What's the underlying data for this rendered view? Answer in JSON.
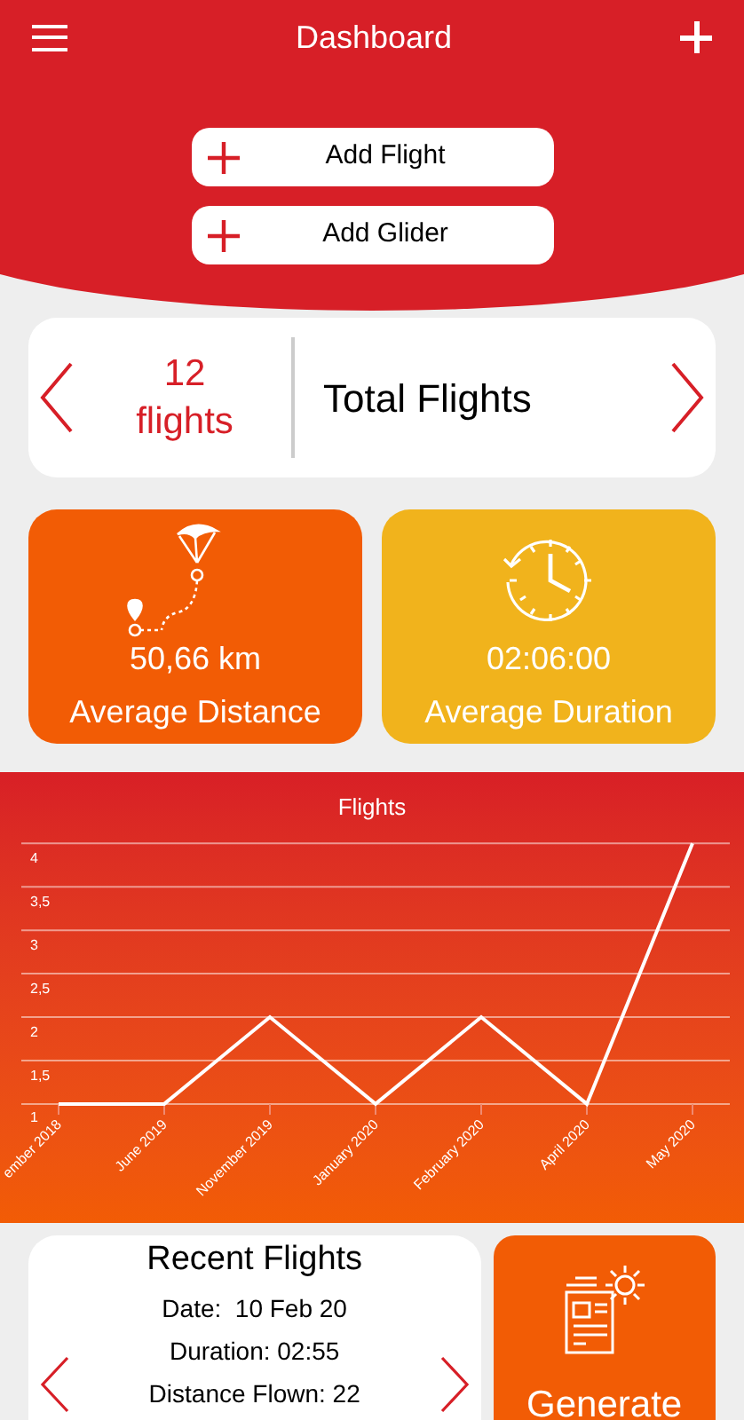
{
  "header": {
    "title": "Dashboard"
  },
  "quick_actions": [
    {
      "label": "Add Flight"
    },
    {
      "label": "Add Glider"
    }
  ],
  "total": {
    "value": "12 flights",
    "label": "Total Flights"
  },
  "stats": [
    {
      "value": "50,66 km",
      "label": "Average Distance",
      "color": "#f25c05"
    },
    {
      "value": "02:06:00",
      "label": "Average Duration",
      "color": "#f1b31c"
    }
  ],
  "chart": {
    "chart_data": {
      "type": "line",
      "title": "Flights",
      "categories": [
        "ember 2018",
        "June 2019",
        "November 2019",
        "January 2020",
        "February 2020",
        "April 2020",
        "May 2020"
      ],
      "series": [
        {
          "color": "#ffffff",
          "values": [
            1,
            1,
            2,
            1,
            2,
            1,
            4
          ]
        }
      ],
      "ylim": [
        -0.37,
        4.82
      ],
      "grid": true,
      "yticks": [
        {
          "value": 1,
          "label": "1"
        },
        {
          "value": 1.5,
          "label": "1,5"
        },
        {
          "value": 2,
          "label": "2"
        },
        {
          "value": 2.5,
          "label": "2,5"
        },
        {
          "value": 3,
          "label": "3"
        },
        {
          "value": 3.5,
          "label": "3,5"
        },
        {
          "value": 4,
          "label": "4"
        }
      ]
    }
  },
  "recent": {
    "title": "Recent Flights",
    "lines": [
      "Date:  10 Feb 20",
      "Duration: 02:55",
      "Distance Flown: 22"
    ]
  },
  "generate": {
    "label": "Generate"
  }
}
